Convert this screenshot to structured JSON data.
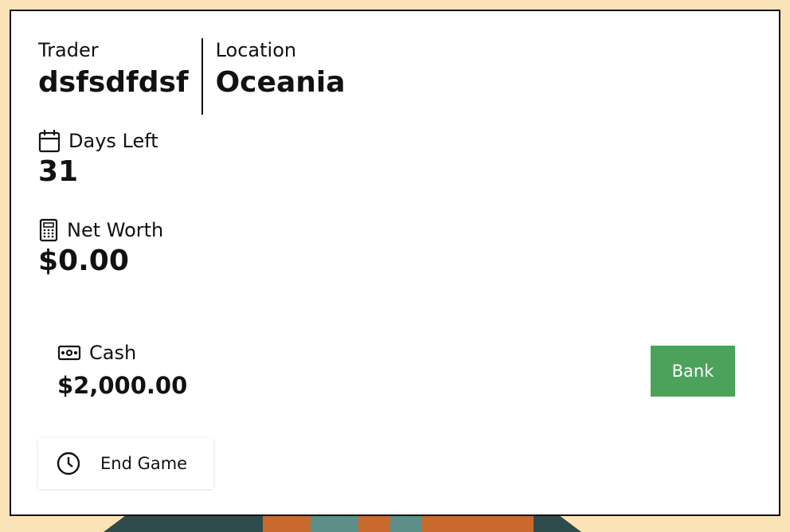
{
  "header": {
    "trader_label": "Trader",
    "trader_name": "dsfsdfdsf",
    "location_label": "Location",
    "location_name": "Oceania"
  },
  "stats": {
    "days_left_label": "Days Left",
    "days_left_value": "31",
    "days_left_icon": "calendar-icon",
    "net_worth_label": "Net Worth",
    "net_worth_value": "$0.00",
    "net_worth_icon": "calculator-icon"
  },
  "cash": {
    "label": "Cash",
    "value": "$2,000.00",
    "icon": "cash-icon"
  },
  "actions": {
    "bank_label": "Bank",
    "end_game_label": "End Game",
    "end_game_icon": "clock-icon"
  },
  "colors": {
    "background": "#fae3b6",
    "bank_button": "#4ca25a",
    "card": "#ffffff"
  }
}
